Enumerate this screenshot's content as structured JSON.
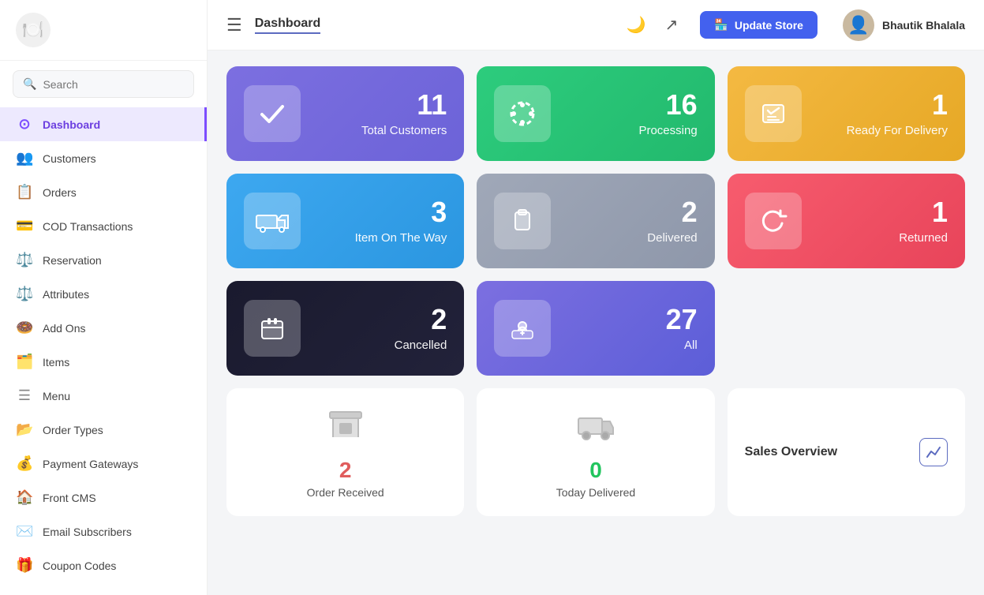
{
  "app": {
    "logo": "🍽️"
  },
  "header": {
    "title": "Dashboard",
    "update_store_label": "Update Store",
    "user_name": "Bhautik Bhalala"
  },
  "search": {
    "placeholder": "Search"
  },
  "sidebar": {
    "items": [
      {
        "id": "dashboard",
        "label": "Dashboard",
        "icon": "⊙",
        "active": true
      },
      {
        "id": "customers",
        "label": "Customers",
        "icon": "👥"
      },
      {
        "id": "orders",
        "label": "Orders",
        "icon": "📋"
      },
      {
        "id": "cod-transactions",
        "label": "COD Transactions",
        "icon": "💳"
      },
      {
        "id": "reservation",
        "label": "Reservation",
        "icon": "⚖️"
      },
      {
        "id": "attributes",
        "label": "Attributes",
        "icon": "⚖️"
      },
      {
        "id": "add-ons",
        "label": "Add Ons",
        "icon": "🍩"
      },
      {
        "id": "items",
        "label": "Items",
        "icon": "🗂️"
      },
      {
        "id": "menu",
        "label": "Menu",
        "icon": "☰"
      },
      {
        "id": "order-types",
        "label": "Order Types",
        "icon": "📂"
      },
      {
        "id": "payment-gateways",
        "label": "Payment Gateways",
        "icon": "💰"
      },
      {
        "id": "front-cms",
        "label": "Front CMS",
        "icon": "🏠"
      },
      {
        "id": "email-subscribers",
        "label": "Email Subscribers",
        "icon": "✉️"
      },
      {
        "id": "coupon-codes",
        "label": "Coupon Codes",
        "icon": "🎁"
      }
    ]
  },
  "stats": [
    {
      "id": "total-customers",
      "number": "11",
      "label": "Total Customers",
      "color": "purple",
      "icon": "✔"
    },
    {
      "id": "processing",
      "number": "16",
      "label": "Processing",
      "color": "green",
      "icon": "⚙"
    },
    {
      "id": "ready-for-delivery",
      "number": "1",
      "label": "Ready For Delivery",
      "color": "yellow",
      "icon": "✔"
    },
    {
      "id": "item-on-the-way",
      "number": "3",
      "label": "Item On The Way",
      "color": "blue",
      "icon": "🚚"
    },
    {
      "id": "delivered",
      "number": "2",
      "label": "Delivered",
      "color": "gray",
      "icon": "📦"
    },
    {
      "id": "returned",
      "number": "1",
      "label": "Returned",
      "color": "red",
      "icon": "↺"
    },
    {
      "id": "cancelled",
      "number": "2",
      "label": "Cancelled",
      "color": "dark",
      "icon": "📅"
    },
    {
      "id": "all",
      "number": "27",
      "label": "All",
      "color": "indigo",
      "icon": "💵"
    }
  ],
  "bottom_cards": [
    {
      "id": "order-received",
      "number": "2",
      "label": "Order Received",
      "number_color": "red",
      "icon": "🏠"
    },
    {
      "id": "today-delivered",
      "number": "0",
      "label": "Today Delivered",
      "number_color": "green",
      "icon": "🚚"
    }
  ],
  "sales_overview": {
    "title": "Sales Overview",
    "icon": "📈"
  }
}
